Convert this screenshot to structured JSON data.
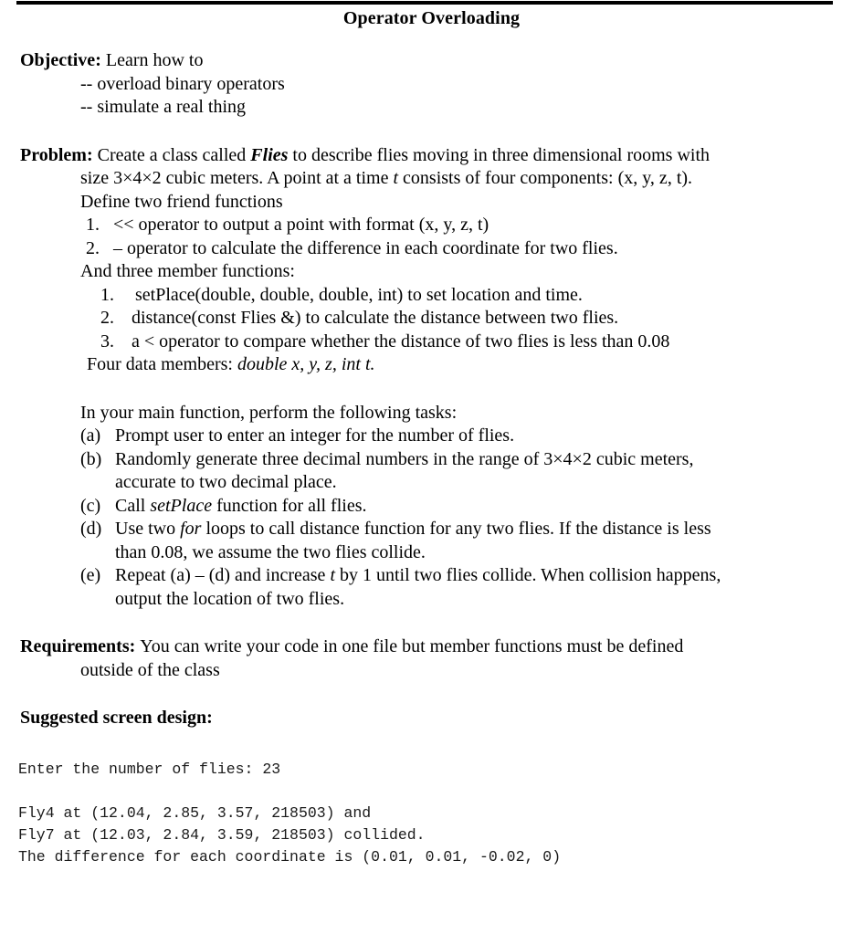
{
  "document": {
    "title": "Operator Overloading"
  },
  "objective": {
    "label": "Objective:",
    "intro": "Learn how to",
    "items": [
      "-- overload binary operators",
      "-- simulate a real thing"
    ]
  },
  "problem": {
    "label": "Problem:",
    "line1_a": "Create a class called ",
    "line1_em": "Flies",
    "line1_b": " to describe flies moving in three dimensional rooms with",
    "line2_a": "size 3×4×2 cubic meters. A point at a time ",
    "line2_em": "t",
    "line2_b": " consists of four components: (x, y, z, t).",
    "line3": "Define two friend functions",
    "friend_functions": [
      {
        "marker": "1.",
        "text": "<< operator to output a point with format (x, y, z, t)"
      },
      {
        "marker": "2.",
        "text": "– operator to calculate the difference in each coordinate for two flies."
      }
    ],
    "member_heading": "And three member functions:",
    "member_functions": [
      {
        "marker": "1.",
        "text": "setPlace(double, double, double, int) to set location and time."
      },
      {
        "marker": "2.",
        "text": "distance(const Flies &) to calculate the distance between two flies."
      },
      {
        "marker": "3.",
        "text": "a < operator to compare whether the distance of two flies is less than 0.08"
      }
    ],
    "data_members_label": "Four data members: ",
    "data_members_em": "double x, y, z, int t."
  },
  "main_function": {
    "intro": "In your main function, perform the following tasks:",
    "tasks": [
      {
        "marker": "(a)",
        "lines": [
          {
            "segments": [
              {
                "text": "Prompt user to enter an integer for the number of flies.",
                "style": "normal"
              }
            ]
          }
        ]
      },
      {
        "marker": "(b)",
        "lines": [
          {
            "segments": [
              {
                "text": "Randomly generate three decimal numbers in the range of 3×4×2 cubic meters,",
                "style": "normal"
              }
            ]
          },
          {
            "segments": [
              {
                "text": "accurate to two decimal place.",
                "style": "normal"
              }
            ]
          }
        ]
      },
      {
        "marker": "(c)",
        "lines": [
          {
            "segments": [
              {
                "text": "Call ",
                "style": "normal"
              },
              {
                "text": "setPlace",
                "style": "italic"
              },
              {
                "text": " function for all flies.",
                "style": "normal"
              }
            ]
          }
        ]
      },
      {
        "marker": "(d)",
        "lines": [
          {
            "segments": [
              {
                "text": "Use two ",
                "style": "normal"
              },
              {
                "text": "for",
                "style": "italic"
              },
              {
                "text": " loops to call distance function for any two flies. If the distance is less",
                "style": "normal"
              }
            ]
          },
          {
            "segments": [
              {
                "text": "than 0.08, we assume the two flies collide.",
                "style": "normal"
              }
            ]
          }
        ]
      },
      {
        "marker": "(e)",
        "lines": [
          {
            "segments": [
              {
                "text": "Repeat (a) – (d) and increase ",
                "style": "normal"
              },
              {
                "text": "t",
                "style": "italic"
              },
              {
                "text": " by 1 until two flies collide. When collision happens,",
                "style": "normal"
              }
            ]
          },
          {
            "segments": [
              {
                "text": "output the location of two flies.",
                "style": "normal"
              }
            ]
          }
        ]
      }
    ]
  },
  "requirements": {
    "label": "Requirements:",
    "line1": "You can write your code in one file but member functions must be defined",
    "line2": "outside of the class"
  },
  "suggested_screen_design": {
    "heading": "Suggested screen design:",
    "console_lines": [
      "Enter the number of flies: 23",
      "",
      "Fly4 at (12.04, 2.85, 3.57, 218503) and",
      "Fly7 at (12.03, 2.84, 3.59, 218503) collided.",
      "The difference for each coordinate is (0.01, 0.01, -0.02, 0)"
    ]
  },
  "colors": {
    "text": "#000000",
    "rule": "#000000",
    "console_text": "#1a1a1a",
    "background": "#ffffff"
  }
}
